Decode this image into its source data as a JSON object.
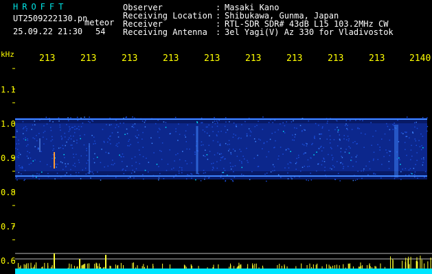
{
  "header": {
    "brand": "HROFFT",
    "filename": "UT2509222130.pn",
    "meteor_label": "meteor",
    "datetime": "25.09.22 21:30",
    "meteor_count": "54"
  },
  "station": [
    {
      "label": "Observer",
      "value": "Masaki Kano"
    },
    {
      "label": "Receiving Location",
      "value": "Shibukawa, Gunma, Japan"
    },
    {
      "label": "Receiver",
      "value": "RTL-SDR SDR# 43dB L15 103.2MHz CW"
    },
    {
      "label": "Receiving Antenna",
      "value": "3el Yagi(V) Az 330 for Vladivostok"
    }
  ],
  "axis": {
    "unit": "kHz",
    "time_ticks": [
      "213",
      "213",
      "213",
      "213",
      "213",
      "213",
      "213",
      "213",
      "213",
      "2140"
    ],
    "freq_ticks": [
      "1.1",
      "1.0",
      "0.9",
      "0.8",
      "0.7",
      "0.6"
    ]
  },
  "colors": {
    "background": "#000000",
    "header_text": "#00e5e5",
    "tick_text": "#ffff00",
    "label_text": "#ffffff",
    "band": "#0a2a8c",
    "band_line": "#2a6bff",
    "baseline": "#00e5ff",
    "spikes": "#ffff33"
  }
}
